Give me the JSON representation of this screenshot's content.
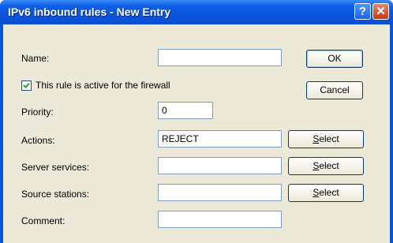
{
  "window": {
    "title": "IPv6 inbound rules - New Entry",
    "help_glyph": "?",
    "close_glyph": "✕"
  },
  "form": {
    "name_label": "Name:",
    "name_value": "",
    "active_label": "This rule is active for the firewall",
    "active_checked": true,
    "priority_label": "Priority:",
    "priority_value": "0",
    "actions_label": "Actions:",
    "actions_value": "REJECT",
    "server_services_label": "Server services:",
    "server_services_value": "",
    "source_stations_label": "Source stations:",
    "source_stations_value": "",
    "comment_label": "Comment:",
    "comment_value": ""
  },
  "buttons": {
    "ok": "OK",
    "cancel": "Cancel",
    "select": "Select"
  },
  "icons": {
    "help": "help-icon",
    "close": "close-icon",
    "check": "checkmark-icon"
  }
}
